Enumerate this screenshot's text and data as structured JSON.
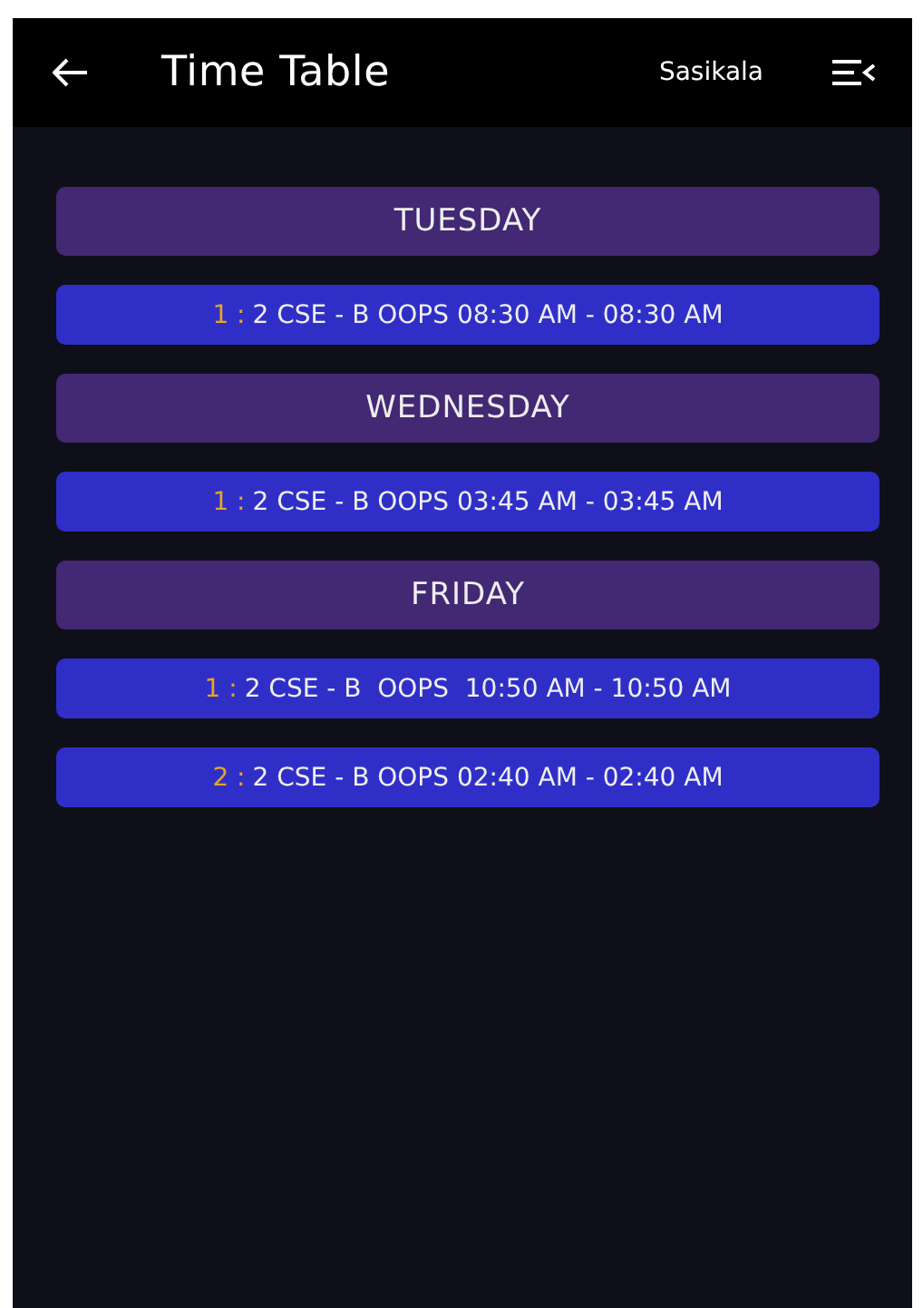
{
  "header": {
    "title": "Time Table",
    "user": "Sasikala"
  },
  "days": [
    {
      "name": "TUESDAY",
      "entries": [
        {
          "index": "1 :",
          "text": "2 CSE - B OOPS 08:30 AM - 08:30 AM"
        }
      ]
    },
    {
      "name": "WEDNESDAY",
      "entries": [
        {
          "index": "1 :",
          "text": "2 CSE - B OOPS 03:45 AM - 03:45 AM"
        }
      ]
    },
    {
      "name": "FRIDAY",
      "entries": [
        {
          "index": "1 :",
          "text": "2 CSE - B  OOPS  10:50 AM - 10:50 AM"
        },
        {
          "index": "2 :",
          "text": "2 CSE - B OOPS 02:40 AM - 02:40 AM"
        }
      ]
    }
  ]
}
